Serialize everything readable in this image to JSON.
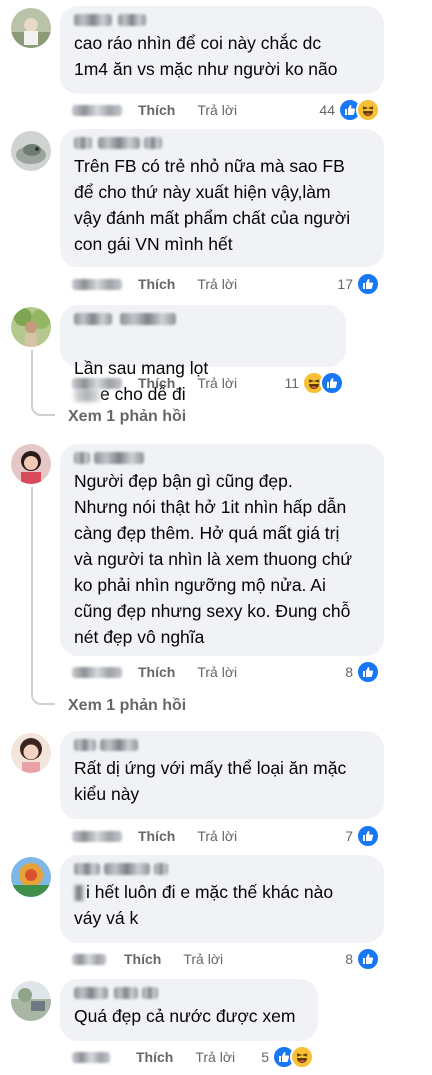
{
  "labels": {
    "like": "Thích",
    "reply": "Trả lời"
  },
  "comments": [
    {
      "text": "cao ráo nhìn để coi này chắc dc\n1m4 ăn vs mặc như người ko não",
      "reactions": "44"
    },
    {
      "text": "Trên FB có trẻ nhỏ nữa mà sao FB\nđể cho thứ này xuất hiện vậy,làm\nvậy đánh mất phẩm chất của người\ncon gái VN mình hết",
      "reactions": "17"
    },
    {
      "text_before": "Lần sau mang lọt",
      "text_after": "e cho dễ đi",
      "reactions": "11",
      "view_replies": "Xem 1 phản hồi"
    },
    {
      "text": "Người đẹp bận gì cũng đẹp.\nNhưng nói thật hở 1it nhìn hấp dẫn\ncàng đẹp thêm. Hở quá mất giá trị\nvà người ta nhìn là xem thuong chứ\nko phải nhìn ngưỡng mộ nửa. Ai\ncũng đẹp nhưng sexy ko. Đung chỗ\nnét đẹp vô nghĩa",
      "reactions": "8",
      "view_replies": "Xem 1 phản hồi"
    },
    {
      "text": "Rất dị ứng với mấy thể loại ăn mặc\nkiểu này",
      "reactions": "7"
    },
    {
      "text": "i hết luôn đi e mặc thế khác nào\nváy vá k",
      "reactions": "8"
    },
    {
      "text": "Quá đẹp cả nước được xem",
      "reactions": "5"
    }
  ],
  "colors": {
    "like_blue": "#1877f2",
    "haha_yellow": "#f7c035",
    "bubble": "#f0f2f5",
    "muted": "#65676b"
  }
}
